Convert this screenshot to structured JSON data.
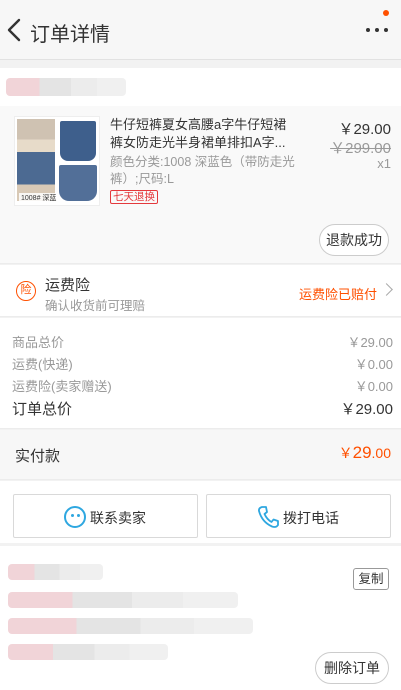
{
  "header": {
    "title": "订单详情",
    "back_icon": "chevron-left-icon",
    "more_icon": "more-dots-icon",
    "notify_color": "#ff5000"
  },
  "product": {
    "name": "牛仔短裤夏女高腰a字牛仔短裙裤女防走光半身裙单排扣A字...",
    "spec": "颜色分类:1008 深蓝色（带防走光裤）;尺码:L",
    "thumb_caption": "1008# 深蓝",
    "badge": "七天退换",
    "price": "￥29.00",
    "original_price": "￥299.00",
    "quantity": "x1",
    "refund_status": "退款成功"
  },
  "insurance": {
    "icon_text": "险",
    "title": "运费险",
    "subtitle": "确认收货前可理赔",
    "status": "运费险已赔付"
  },
  "summary": {
    "rows": [
      {
        "label": "商品总价",
        "value": "￥29.00"
      },
      {
        "label": "运费(快递)",
        "value": "￥0.00"
      },
      {
        "label": "运费险(卖家赠送)",
        "value": "￥0.00"
      }
    ],
    "total_label": "订单总价",
    "total_value": "￥29.00"
  },
  "paid": {
    "label": "实付款",
    "currency": "￥",
    "integer": "29",
    "decimal": ".00"
  },
  "actions": {
    "contact_seller": "联系卖家",
    "call_phone": "拨打电话"
  },
  "order": {
    "copy_label": "复制",
    "delete_label": "删除订单"
  },
  "colors": {
    "accent": "#ff5000",
    "badge": "#e4393c",
    "contact_icon": "#2ea7e0"
  }
}
